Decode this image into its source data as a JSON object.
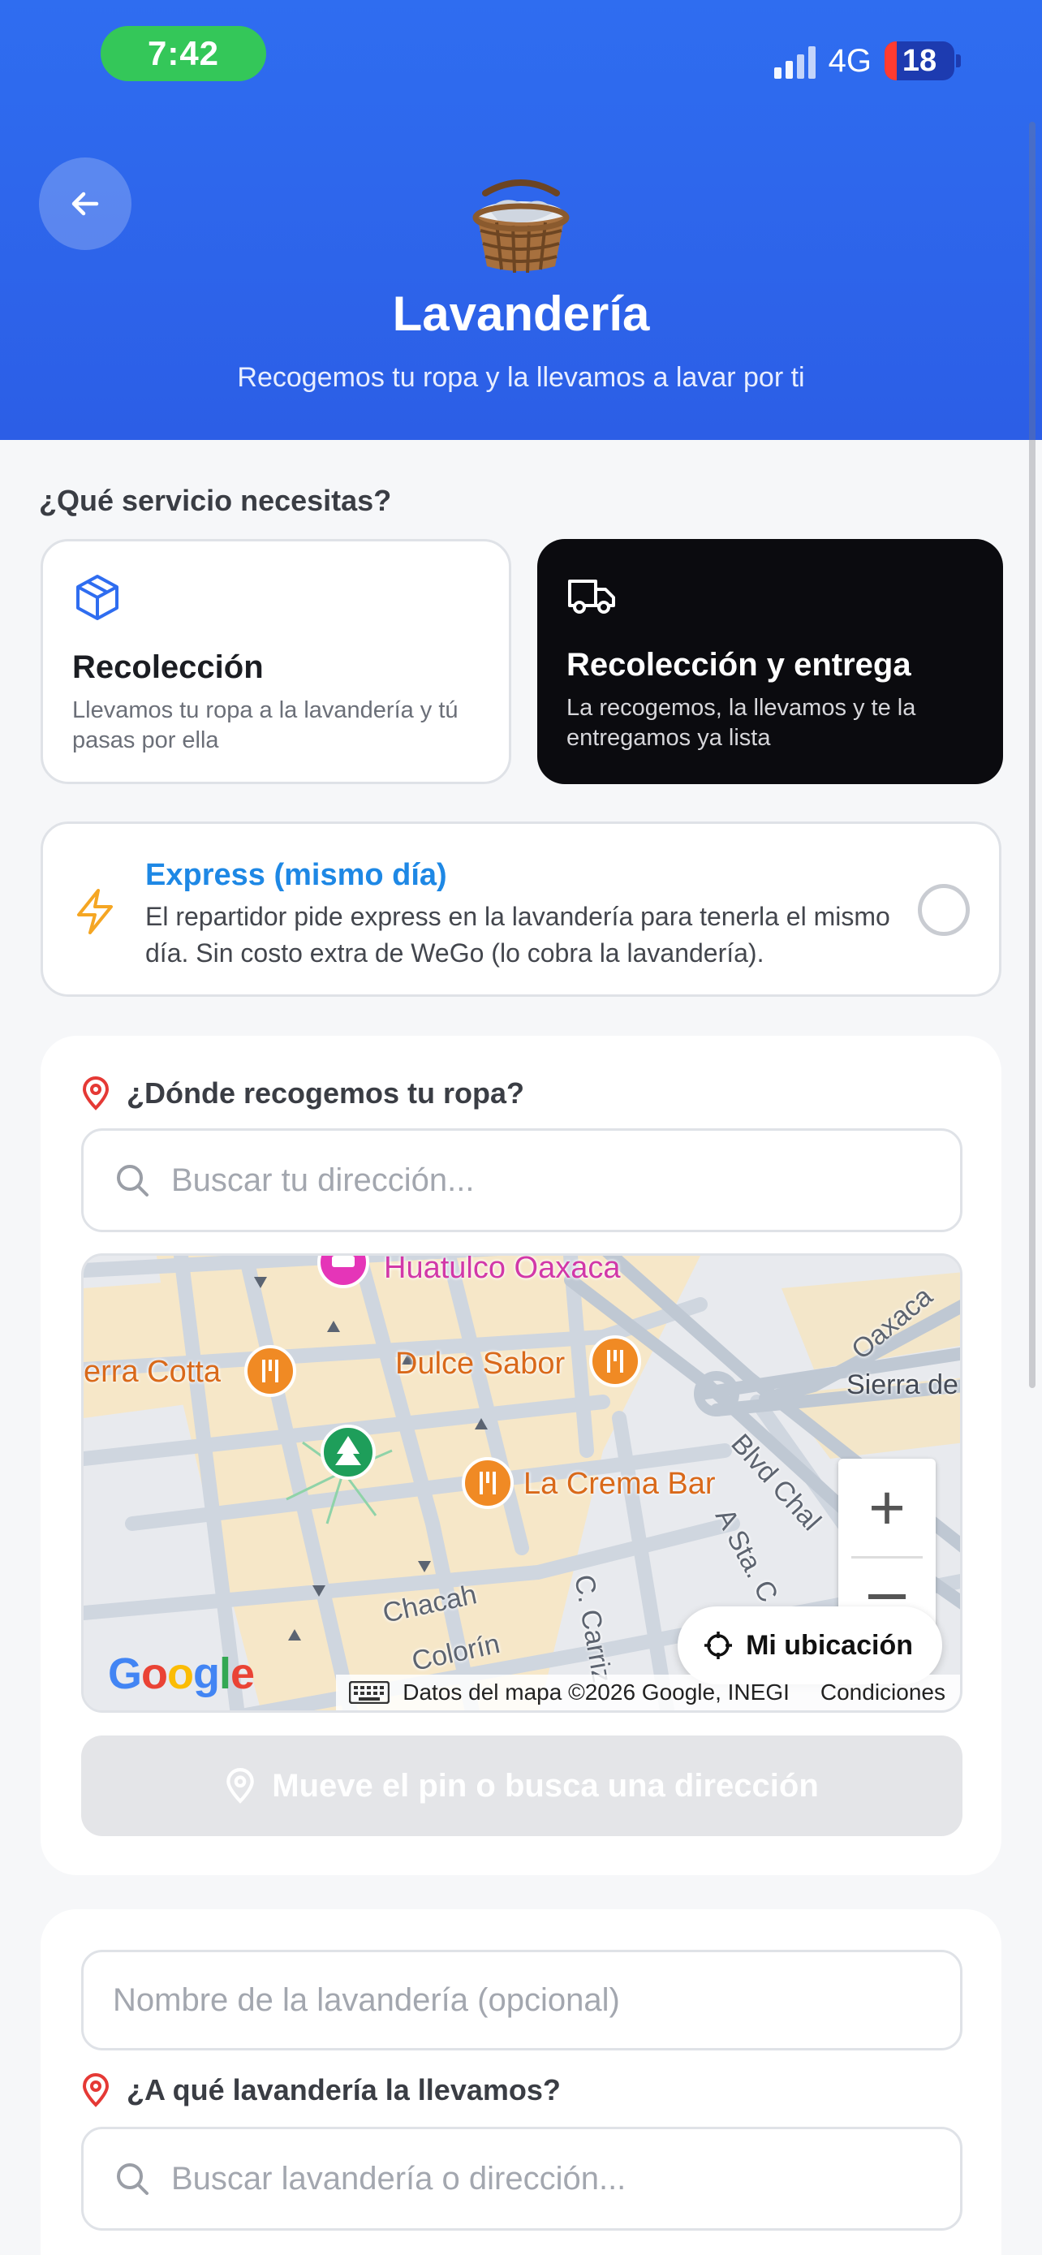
{
  "status_bar": {
    "time": "7:42",
    "network": "4G",
    "battery": "18"
  },
  "header": {
    "title": "Lavandería",
    "subtitle": "Recogemos tu ropa y la llevamos a lavar por ti",
    "hero_icon": "laundry-basket-emoji",
    "back_icon": "arrow-left-icon"
  },
  "service": {
    "label": "¿Qué servicio necesitas?",
    "options": [
      {
        "title": "Recolección",
        "description": "Llevamos tu ropa a la lavandería y tú pasas por ella",
        "icon": "box-icon",
        "selected": false
      },
      {
        "title": "Recolección y entrega",
        "description": "La recogemos, la llevamos y te la entregamos ya lista",
        "icon": "truck-icon",
        "selected": true
      }
    ]
  },
  "express": {
    "title": "Express (mismo día)",
    "description": "El repartidor pide express en la lavandería para tenerla el mismo día. Sin costo extra de WeGo (lo cobra la lavandería).",
    "icon": "lightning-icon",
    "checked": false
  },
  "pickup": {
    "question": "¿Dónde recogemos tu ropa?",
    "search_placeholder": "Buscar tu dirección...",
    "map": {
      "places": [
        "Huatulco Oaxaca",
        "erra Cotta",
        "Dulce Sabor",
        "La Crema Bar"
      ],
      "streets": [
        "Oaxaca",
        "Sierra de",
        "Blvd Chal",
        "A Sta. C",
        "Chacah",
        "Colorín",
        "C. Carriz"
      ],
      "logo": [
        "G",
        "o",
        "o",
        "g",
        "l",
        "e"
      ],
      "attribution": "Datos del mapa ©2026 Google, INEGI",
      "terms": "Condiciones",
      "my_location": "Mi ubicación",
      "zoom_in": "+"
    },
    "cta": "Mueve el pin o busca una dirección"
  },
  "laundry": {
    "name_placeholder": "Nombre de la lavandería (opcional)",
    "question": "¿A qué lavandería la llevamos?",
    "search_placeholder": "Buscar lavandería o dirección..."
  },
  "colors": {
    "header": "#2f6df0",
    "selected_card": "#0b0b0f",
    "express_title": "#1e88e5",
    "pin_red": "#e53935",
    "cta_disabled": "#e4e5e8"
  }
}
